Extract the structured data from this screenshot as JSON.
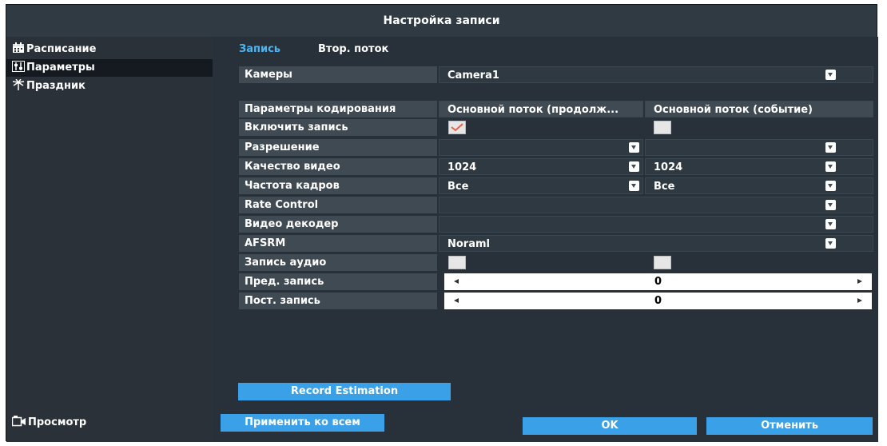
{
  "window": {
    "title": "Настройка записи"
  },
  "sidebar": {
    "items": [
      {
        "label": "Расписание",
        "icon": "calendar-icon"
      },
      {
        "label": "Параметры",
        "icon": "parameters-icon"
      },
      {
        "label": "Праздник",
        "icon": "palm-tree-icon"
      }
    ],
    "bottom": {
      "label": "Просмотр",
      "icon": "camera-icon"
    }
  },
  "tabs": [
    {
      "label": "Запись",
      "active": true
    },
    {
      "label": "Втор. поток",
      "active": false
    }
  ],
  "form": {
    "camera_label": "Камеры",
    "camera_value": "Camera1",
    "header_label": "Параметры кодирования",
    "col1": "Основной поток (продолж...",
    "col2": "Основной поток (событие)",
    "enable_label": "Включить запись",
    "resolution_label": "Разрешение",
    "quality_label": "Качество видео",
    "quality_col1": "1024",
    "quality_col2": "1024",
    "fps_label": "Частота кадров",
    "fps_col1": "Все",
    "fps_col2": "Все",
    "rate_label": "Rate Control",
    "decoder_label": "Видео декодер",
    "afsrm_label": "AFSRM",
    "afsrm_value": "Noraml",
    "audio_label": "Запись аудио",
    "pre_label": "Пред. запись",
    "pre_value": "0",
    "post_label": "Пост. запись",
    "post_value": "0"
  },
  "buttons": {
    "estimation": "Record Estimation",
    "apply_all": "Применить ко всем",
    "ok": "OK",
    "cancel": "Отменить"
  },
  "colors": {
    "accent": "#3aa0e8",
    "tab_active": "#4fb3f0",
    "panel": "#283139",
    "label_bg": "#404a53",
    "check": "#e8604a"
  }
}
